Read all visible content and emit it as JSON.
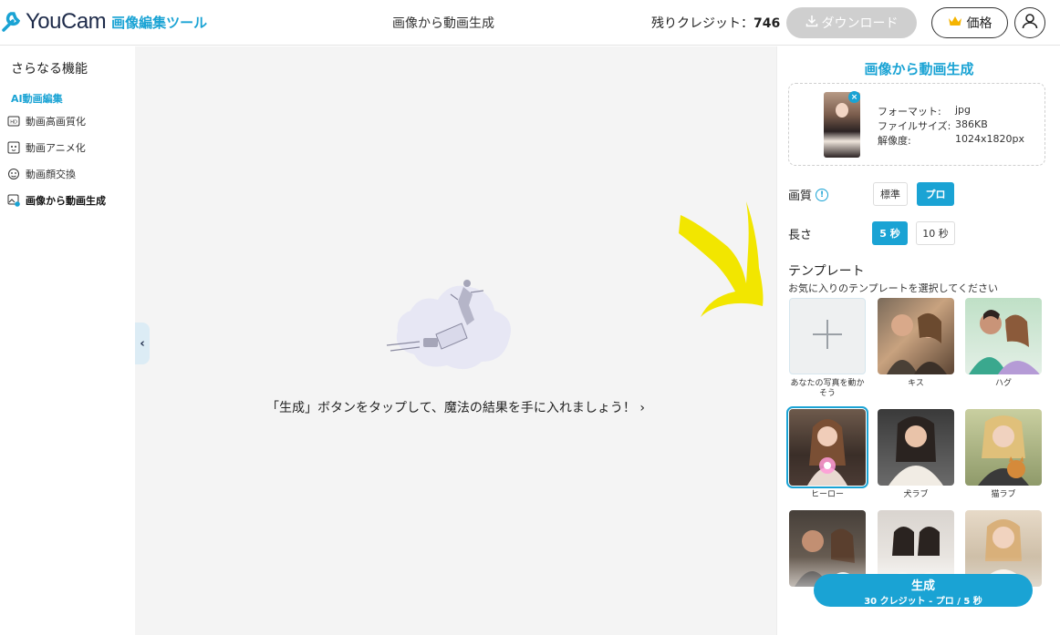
{
  "header": {
    "logo_text": "YouCam",
    "logo_sub": "画像編集ツール",
    "title": "画像から動画生成",
    "credits_label": "残りクレジット：",
    "credits_value": "746",
    "download_label": "ダウンロード",
    "price_label": "価格"
  },
  "sidebar": {
    "title": "さらなる機能",
    "section": "AI動画編集",
    "items": [
      {
        "label": "動画高画質化",
        "icon": "hd-video-icon"
      },
      {
        "label": "動画アニメ化",
        "icon": "anime-face-icon"
      },
      {
        "label": "動画顔交換",
        "icon": "face-swap-icon"
      },
      {
        "label": "画像から動画生成",
        "icon": "image-to-video-icon"
      }
    ]
  },
  "main": {
    "hint": "「生成」ボタンをタップして、魔法の結果を手に入れましょう！ ›"
  },
  "panel": {
    "title": "画像から動画生成",
    "file": {
      "format_label": "フォーマット:",
      "format_value": "jpg",
      "size_label": "ファイルサイズ:",
      "size_value": "386KB",
      "resolution_label": "解像度:",
      "resolution_value": "1024x1820px"
    },
    "quality_label": "画質",
    "quality_options": [
      "標準",
      "プロ"
    ],
    "quality_selected": "プロ",
    "length_label": "長さ",
    "length_options": [
      "5 秒",
      "10 秒"
    ],
    "length_selected": "5 秒",
    "template_title": "テンプレート",
    "template_sub": "お気に入りのテンプレートを選択してください",
    "templates": [
      {
        "label": "あなたの写真を動かそう"
      },
      {
        "label": "キス"
      },
      {
        "label": "ハグ"
      },
      {
        "label": "ヒーロー"
      },
      {
        "label": "犬ラブ"
      },
      {
        "label": "猫ラブ"
      },
      {
        "label": ""
      },
      {
        "label": ""
      },
      {
        "label": ""
      }
    ],
    "generate_label": "生成",
    "generate_sub": "30 クレジット - プロ / 5 秒"
  },
  "colors": {
    "accent": "#1aa3d4",
    "annotation_arrow": "#f2e600"
  }
}
